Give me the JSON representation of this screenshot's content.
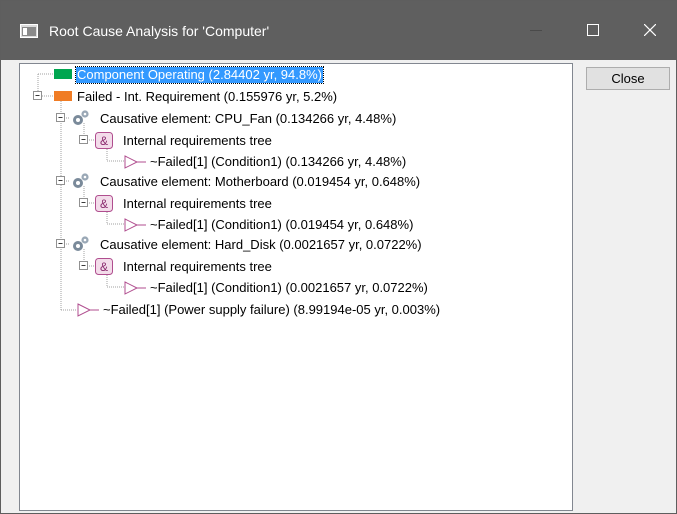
{
  "window": {
    "title": "Root Cause Analysis for 'Computer'"
  },
  "buttons": {
    "close_label": "Close"
  },
  "colors": {
    "titlebar": "#5f5f5f",
    "selection": "#3399ff",
    "operating": "#00a650",
    "failed": "#f07c24",
    "and_gate": "#c0509b"
  },
  "icons": {
    "status_ok": "green-bar-icon",
    "status_failed": "orange-bar-icon",
    "causative": "gears-icon",
    "and_gate": "and-gate-icon",
    "condition": "triangle-icon"
  },
  "tree": {
    "root_operating": "Component Operating (2.84402 yr, 94.8%)",
    "root_failed": "Failed - Int. Requirement (0.155976 yr, 5.2%)",
    "causes": [
      {
        "label": "Causative element: CPU_Fan (0.134266 yr, 4.48%)",
        "subtree": "Internal requirements tree",
        "leaf": "~Failed[1]  (Condition1) (0.134266 yr, 4.48%)"
      },
      {
        "label": "Causative element: Motherboard (0.019454 yr, 0.648%)",
        "subtree": "Internal requirements tree",
        "leaf": "~Failed[1]  (Condition1) (0.019454 yr, 0.648%)"
      },
      {
        "label": "Causative element: Hard_Disk (0.0021657 yr, 0.0722%)",
        "subtree": "Internal requirements tree",
        "leaf": "~Failed[1]  (Condition1) (0.0021657 yr, 0.0722%)"
      }
    ],
    "power_leaf": "~Failed[1]  (Power supply failure) (8.99194e-05 yr, 0.003%)"
  }
}
